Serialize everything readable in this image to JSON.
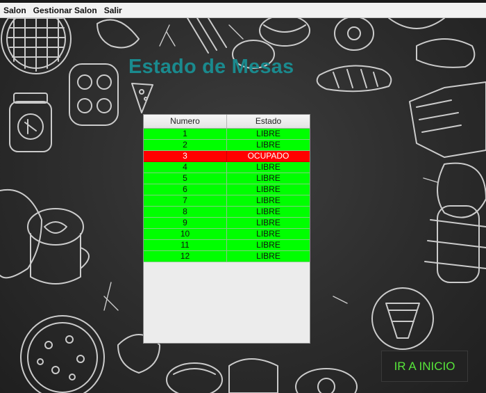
{
  "menubar": {
    "items": [
      "Salon",
      "Gestionar Salon",
      "Salir"
    ]
  },
  "page": {
    "title": "Estado de Mesas"
  },
  "table": {
    "columns": [
      "Numero",
      "Estado"
    ],
    "rows": [
      {
        "numero": "1",
        "estado": "LIBRE"
      },
      {
        "numero": "2",
        "estado": "LIBRE"
      },
      {
        "numero": "3",
        "estado": "OCUPADO"
      },
      {
        "numero": "4",
        "estado": "LIBRE"
      },
      {
        "numero": "5",
        "estado": "LIBRE"
      },
      {
        "numero": "6",
        "estado": "LIBRE"
      },
      {
        "numero": "7",
        "estado": "LIBRE"
      },
      {
        "numero": "8",
        "estado": "LIBRE"
      },
      {
        "numero": "9",
        "estado": "LIBRE"
      },
      {
        "numero": "10",
        "estado": "LIBRE"
      },
      {
        "numero": "11",
        "estado": "LIBRE"
      },
      {
        "numero": "12",
        "estado": "LIBRE"
      }
    ]
  },
  "button": {
    "ir_inicio": "IR A INICIO"
  },
  "colors": {
    "title": "#1a8a8e",
    "libre": "#00ff00",
    "ocupado": "#ff0000",
    "button_text": "#57e63a",
    "background": "#2b2b2b"
  }
}
